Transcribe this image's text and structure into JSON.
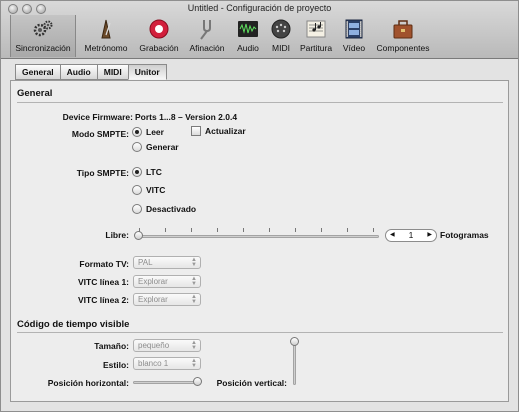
{
  "window": {
    "title": "Untitled - Configuración de proyecto"
  },
  "toolbar": [
    {
      "label": "Sincronización",
      "icon": "gears-icon",
      "selected": true
    },
    {
      "label": "Metrónomo",
      "icon": "metronome-icon"
    },
    {
      "label": "Grabación",
      "icon": "record-icon"
    },
    {
      "label": "Afinación",
      "icon": "tuning-fork-icon"
    },
    {
      "label": "Audio",
      "icon": "audio-waveform-icon"
    },
    {
      "label": "MIDI",
      "icon": "midi-plug-icon"
    },
    {
      "label": "Partitura",
      "icon": "score-icon"
    },
    {
      "label": "Vídeo",
      "icon": "film-icon"
    },
    {
      "label": "Componentes",
      "icon": "toolbox-icon"
    }
  ],
  "tabs": [
    {
      "label": "General"
    },
    {
      "label": "Audio"
    },
    {
      "label": "MIDI"
    },
    {
      "label": "Unitor",
      "active": true
    }
  ],
  "general": {
    "heading": "General",
    "firmware_label": "Device Firmware:",
    "firmware_value": "Ports 1...8 – Version 2.0.4",
    "smpte_mode_label": "Modo SMPTE:",
    "smpte_mode_options": [
      "Leer",
      "Generar"
    ],
    "smpte_mode_selected": "Leer",
    "update_label": "Actualizar",
    "update_checked": false,
    "smpte_type_label": "Tipo SMPTE:",
    "smpte_type_options": [
      "LTC",
      "VITC",
      "Desactivado"
    ],
    "smpte_type_selected": "LTC",
    "free_label": "Libre:",
    "free_slider_level": 0,
    "frames_value": "1",
    "frames_label": "Fotogramas",
    "tv_format_label": "Formato TV:",
    "tv_format_value": "PAL",
    "vitc1_label": "VITC línea 1:",
    "vitc1_value": "Explorar",
    "vitc2_label": "VITC línea 2:",
    "vitc2_value": "Explorar"
  },
  "timecode": {
    "heading": "Código de tiempo visible",
    "size_label": "Tamaño:",
    "size_value": "pequeño",
    "style_label": "Estilo:",
    "style_value": "blanco 1",
    "hpos_label": "Posición horizontal:",
    "hpos_level": 1,
    "vpos_label": "Posición vertical:",
    "vpos_level": 1
  }
}
